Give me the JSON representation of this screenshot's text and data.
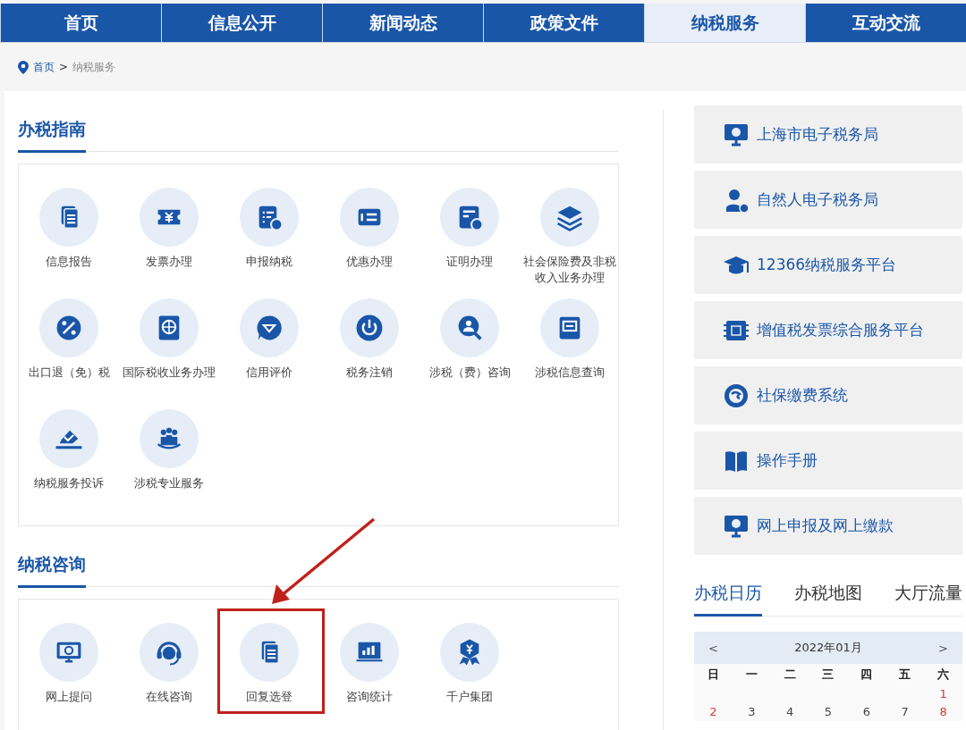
{
  "nav": [
    {
      "label": "首页",
      "selected": false
    },
    {
      "label": "信息公开",
      "selected": false
    },
    {
      "label": "新闻动态",
      "selected": false
    },
    {
      "label": "政策文件",
      "selected": false
    },
    {
      "label": "纳税服务",
      "selected": true
    },
    {
      "label": "互动交流",
      "selected": false
    }
  ],
  "breadcrumb": {
    "home": "首页",
    "separator": ">",
    "current": "纳税服务"
  },
  "guide": {
    "title": "办税指南",
    "items": [
      {
        "label": "信息报告"
      },
      {
        "label": "发票办理"
      },
      {
        "label": "申报纳税"
      },
      {
        "label": "优惠办理"
      },
      {
        "label": "证明办理"
      },
      {
        "label": "社会保险费及非税收入业务办理"
      },
      {
        "label": "出口退（免）税"
      },
      {
        "label": "国际税收业务办理"
      },
      {
        "label": "信用评价"
      },
      {
        "label": "税务注销"
      },
      {
        "label": "涉税（费）咨询"
      },
      {
        "label": "涉税信息查询"
      },
      {
        "label": "纳税服务投诉"
      },
      {
        "label": "涉税专业服务"
      }
    ]
  },
  "consult": {
    "title": "纳税咨询",
    "items": [
      {
        "label": "网上提问",
        "highlighted": false
      },
      {
        "label": "在线咨询",
        "highlighted": false
      },
      {
        "label": "回复选登",
        "highlighted": true
      },
      {
        "label": "咨询统计",
        "highlighted": false
      },
      {
        "label": "千户集团",
        "highlighted": false
      }
    ]
  },
  "links": [
    "上海市电子税务局",
    "自然人电子税务局",
    "12366纳税服务平台",
    "增值税发票综合服务平台",
    "社保缴费系统",
    "操作手册",
    "网上申报及网上缴款"
  ],
  "side_tabs": [
    {
      "label": "办税日历",
      "selected": true
    },
    {
      "label": "办税地图",
      "selected": false
    },
    {
      "label": "大厅流量",
      "selected": false
    }
  ],
  "calendar": {
    "prev": "<",
    "month": "2022年01月",
    "next": ">",
    "weekdays": [
      "日",
      "一",
      "二",
      "三",
      "四",
      "五",
      "六"
    ],
    "weeks": [
      [
        {
          "day": "1",
          "red": true
        }
      ],
      [
        {
          "day": "2",
          "red": true
        },
        {
          "day": "3",
          "red": false
        },
        {
          "day": "4",
          "red": false
        },
        {
          "day": "5",
          "red": false
        },
        {
          "day": "6",
          "red": false
        },
        {
          "day": "7",
          "red": false
        },
        {
          "day": "8",
          "red": true
        }
      ]
    ]
  }
}
